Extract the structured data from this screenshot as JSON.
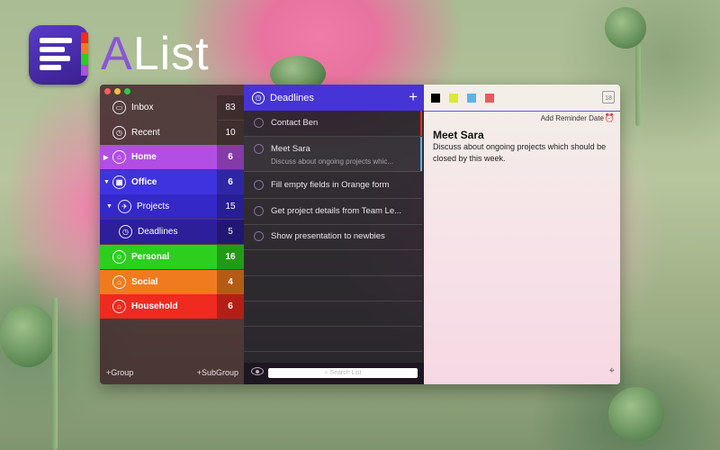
{
  "brand": {
    "name_first": "A",
    "name_rest": "List"
  },
  "colors": {
    "accent": "#4634d6"
  },
  "sidebar": {
    "items": [
      {
        "label": "Inbox",
        "count": "83",
        "icon": "inbox-icon",
        "color": "transparent"
      },
      {
        "label": "Recent",
        "count": "10",
        "icon": "clock-icon",
        "color": "transparent"
      },
      {
        "label": "Home",
        "count": "6",
        "icon": "home-icon",
        "color": "#b24ee3"
      },
      {
        "label": "Office",
        "count": "6",
        "icon": "office-icon",
        "color": "#3f33df"
      },
      {
        "label": "Projects",
        "count": "15",
        "icon": "rocket-icon",
        "color": "#3528c9"
      },
      {
        "label": "Deadlines",
        "count": "5",
        "icon": "clock-icon",
        "color": "#2d1f9a"
      },
      {
        "label": "Personal",
        "count": "16",
        "icon": "person-icon",
        "color": "#2ccf1e"
      },
      {
        "label": "Social",
        "count": "4",
        "icon": "home-icon",
        "color": "#f07b1e"
      },
      {
        "label": "Household",
        "count": "6",
        "icon": "home-icon",
        "color": "#ef2a1e"
      }
    ],
    "add_group": "+Group",
    "add_subgroup": "+SubGroup"
  },
  "list": {
    "title": "Deadlines",
    "add": "+",
    "search_placeholder": "Search List",
    "tasks": [
      {
        "title": "Contact Ben",
        "subtitle": ""
      },
      {
        "title": "Meet Sara",
        "subtitle": "Discuss about ongoing projects whic..."
      },
      {
        "title": "Fill empty fields in Orange form",
        "subtitle": ""
      },
      {
        "title": "Get project details from Team Le...",
        "subtitle": ""
      },
      {
        "title": "Show presentation to newbies",
        "subtitle": ""
      }
    ]
  },
  "detail": {
    "swatches": [
      "#000000",
      "#dde83a",
      "#5fb2e8",
      "#ec5a5a"
    ],
    "calendar_day": "18",
    "add_reminder": "Add Reminder Date",
    "title": "Meet Sara",
    "note": "Discuss about ongoing projects which should be closed by this week."
  }
}
